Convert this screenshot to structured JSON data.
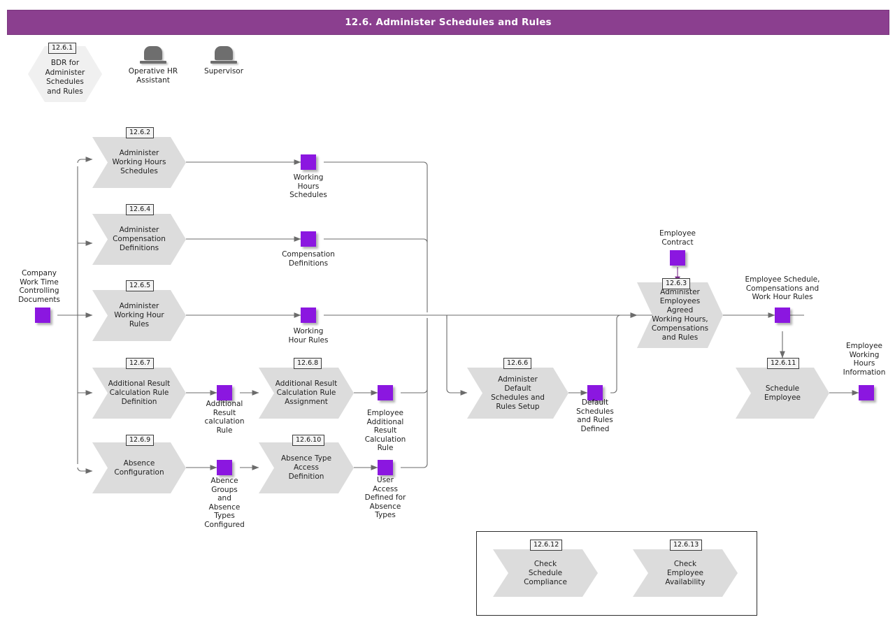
{
  "header": {
    "title": "12.6. Administer Schedules and Rules",
    "bar_color": "#8b3f8f",
    "text_color": "#ffffff"
  },
  "palette": {
    "process_fill": "#dcdcdc",
    "hexagon_fill": "#f0f0f0",
    "data_object_fill": "#8b17e0",
    "connector": "#6b6b6b",
    "role_icon": "#6e6e6e",
    "badge_fill": "#f4f4f4"
  },
  "bdr": {
    "id": "12.6.1",
    "label": "BDR for\nAdminister\nSchedules\nand Rules"
  },
  "roles": [
    {
      "name": "Operative HR\nAssistant",
      "icon": "role-person-icon"
    },
    {
      "name": "Supervisor",
      "icon": "role-person-icon"
    }
  ],
  "processes": [
    {
      "id": "12.6.2",
      "label": "Administer\nWorking Hours\nSchedules"
    },
    {
      "id": "12.6.4",
      "label": "Administer\nCompensation\nDefinitions"
    },
    {
      "id": "12.6.5",
      "label": "Administer\nWorking Hour\nRules"
    },
    {
      "id": "12.6.7",
      "label": "Additional Result\nCalculation Rule\nDefinition"
    },
    {
      "id": "12.6.9",
      "label": "Absence\nConfiguration"
    },
    {
      "id": "12.6.8",
      "label": "Additional Result\nCalculation Rule\nAssignment"
    },
    {
      "id": "12.6.10",
      "label": "Absence Type\nAccess\nDefinition"
    },
    {
      "id": "12.6.6",
      "label": "Administer\nDefault\nSchedules and\nRules Setup"
    },
    {
      "id": "12.6.3",
      "label": "Administer\nEmployees\nAgreed\nWorking Hours,\nCompensations\nand Rules"
    },
    {
      "id": "12.6.11",
      "label": "Schedule\nEmployee"
    },
    {
      "id": "12.6.12",
      "label": "Check\nSchedule\nCompliance"
    },
    {
      "id": "12.6.13",
      "label": "Check\nEmployee\nAvailability"
    }
  ],
  "data_objects": [
    {
      "key": "company_docs",
      "label": "Company\nWork Time\nControlling\nDocuments"
    },
    {
      "key": "working_hours_sched",
      "label": "Working\nHours\nSchedules"
    },
    {
      "key": "compensation_defs",
      "label": "Compensation\nDefinitions"
    },
    {
      "key": "working_hour_rules",
      "label": "Working\nHour Rules"
    },
    {
      "key": "addl_result_rule",
      "label": "Additional\nResult\ncalculation\nRule"
    },
    {
      "key": "emp_addl_result",
      "label": "Employee\nAdditional\nResult\nCalculation\nRule"
    },
    {
      "key": "absence_groups",
      "label": "Abence\nGroups\nand\nAbsence\nTypes\nConfigured"
    },
    {
      "key": "user_access",
      "label": "User\nAccess\nDefined for\nAbsence\nTypes"
    },
    {
      "key": "default_defined",
      "label": "Default\nSchedules\nand Rules\nDefined"
    },
    {
      "key": "employee_contract",
      "label": "Employee\nContract"
    },
    {
      "key": "emp_schedule_comp",
      "label": "Employee Schedule,\nCompensations and\nWork Hour Rules"
    },
    {
      "key": "emp_working_info",
      "label": "Employee\nWorking\nHours\nInformation"
    }
  ]
}
